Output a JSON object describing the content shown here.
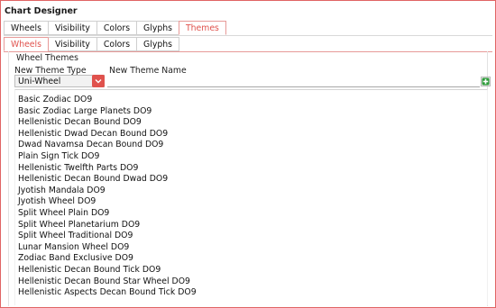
{
  "window": {
    "title": "Chart Designer"
  },
  "outer_tabs": [
    "Wheels",
    "Visibility",
    "Colors",
    "Glyphs",
    "Themes"
  ],
  "outer_active": "Themes",
  "inner_tabs": [
    "Wheels",
    "Visibility",
    "Colors",
    "Glyphs"
  ],
  "inner_active": "Wheels",
  "section": {
    "title": "Wheel Themes"
  },
  "theme_type": {
    "label": "New Theme Type",
    "value": "Uni-Wheel",
    "icon": "chevron-down-icon"
  },
  "theme_name": {
    "label": "New Theme Name",
    "value": "",
    "placeholder": ""
  },
  "add_button": {
    "icon": "add-icon"
  },
  "themes": [
    "Basic Zodiac DO9",
    "Basic Zodiac Large Planets DO9",
    "Hellenistic Decan Bound DO9",
    "Hellenistic Dwad Decan Bound DO9",
    "Dwad Navamsa Decan Bound DO9",
    "Plain Sign Tick DO9",
    "Hellenistic Twelfth Parts DO9",
    "Hellenistic Decan Bound Dwad DO9",
    "Jyotish Mandala DO9",
    "Jyotish Wheel DO9",
    "Split Wheel Plain DO9",
    "Split Wheel Planetarium DO9",
    "Split Wheel Traditional DO9",
    "Lunar Mansion Wheel DO9",
    "Zodiac Band Exclusive DO9",
    "Hellenistic Decan Bound Tick DO9",
    "Hellenistic Decan Bound Star Wheel DO9",
    "Hellenistic Aspects Decan Bound Tick DO9"
  ],
  "colors": {
    "accent": "#e0524d",
    "add_green": "#2e9b3a"
  }
}
